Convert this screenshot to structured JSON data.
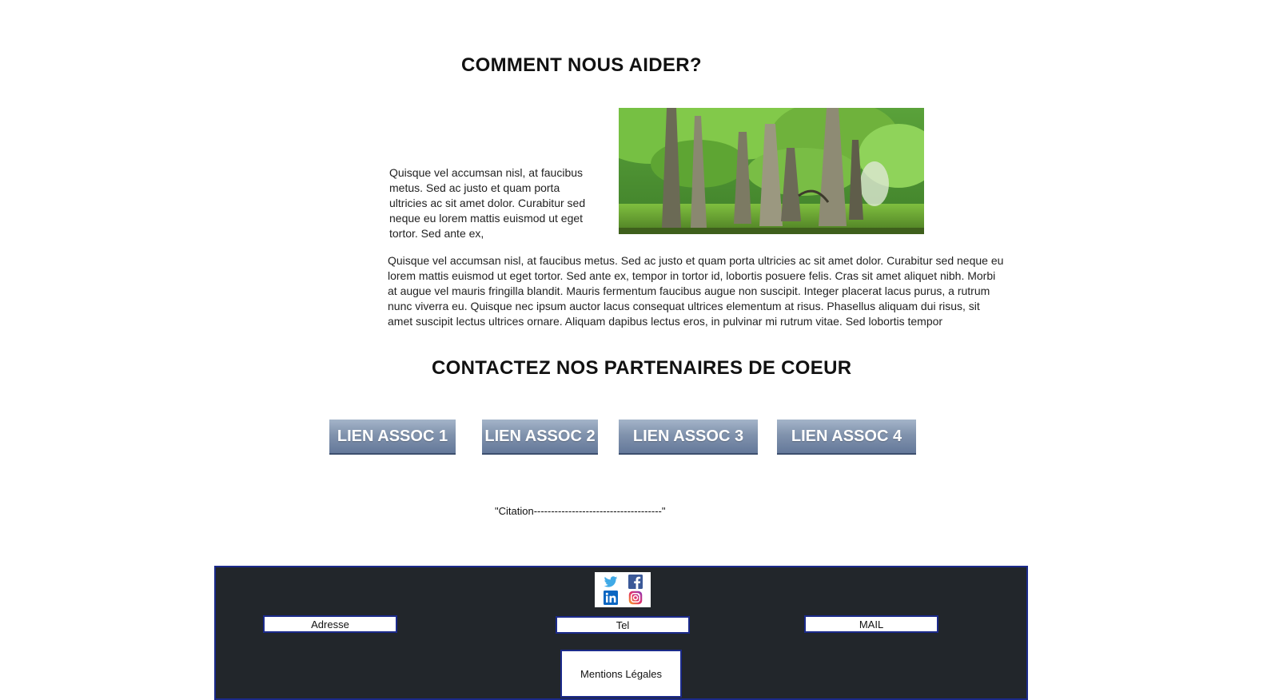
{
  "sections": {
    "help_title": "COMMENT NOUS AIDER?",
    "partners_title": "CONTACTEZ NOS PARTENAIRES DE COEUR"
  },
  "intro_text": "Quisque vel accumsan nisl, at faucibus metus. Sed ac justo et quam porta ultricies ac sit amet dolor. Curabitur sed neque eu lorem mattis euismod ut eget tortor. Sed ante ex,",
  "body_text": "Quisque vel accumsan nisl, at faucibus metus. Sed ac justo et quam porta ultricies ac sit amet dolor. Curabitur sed neque eu lorem mattis euismod ut eget tortor. Sed ante ex, tempor in tortor id, lobortis posuere felis. Cras sit amet aliquet nibh. Morbi at augue vel mauris fringilla blandit. Mauris fermentum faucibus augue non suscipit. Integer placerat lacus purus, a rutrum nunc viverra eu. Quisque nec ipsum auctor lacus consequat ultrices elementum at risus. Phasellus aliquam dui risus, sit amet suscipit lectus ultrices ornare. Aliquam dapibus lectus eros, in pulvinar mi rutrum vitae. Sed lobortis tempor",
  "assoc_buttons": [
    "LIEN ASSOC 1",
    "LIEN ASSOC 2",
    "LIEN ASSOC 3",
    "LIEN ASSOC 4"
  ],
  "quote": "\"Citation-------------------------------------\"",
  "footer": {
    "social_icons": [
      "twitter-icon",
      "facebook-icon",
      "linkedin-icon",
      "instagram-icon"
    ],
    "adresse": "Adresse",
    "tel": "Tel",
    "mail": "MAIL",
    "mentions": "Mentions Légales"
  },
  "colors": {
    "footer_bg": "#22262b",
    "footer_border": "#1b2a8a",
    "button_gradient_top": "#a4b4c9",
    "button_gradient_bottom": "#64789a"
  }
}
